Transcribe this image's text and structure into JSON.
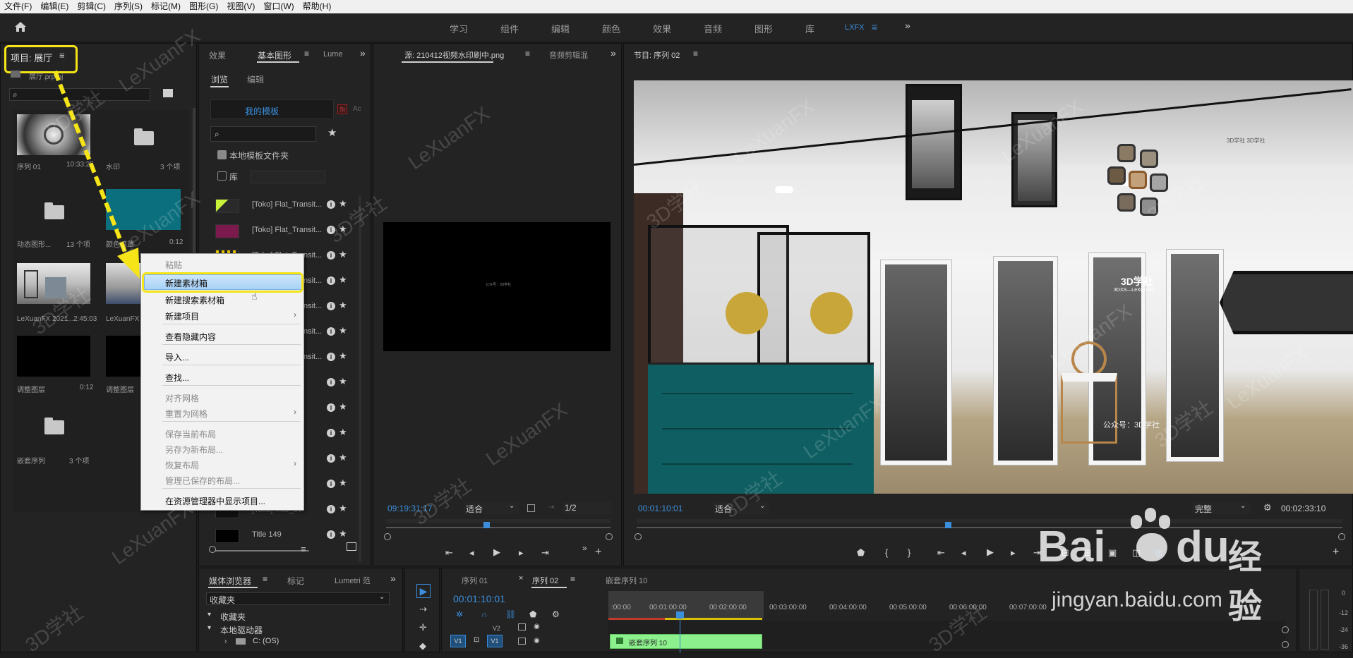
{
  "menu": [
    "文件(F)",
    "编辑(E)",
    "剪辑(C)",
    "序列(S)",
    "标记(M)",
    "图形(G)",
    "视图(V)",
    "窗口(W)",
    "帮助(H)"
  ],
  "workspaces": [
    "学习",
    "组件",
    "编辑",
    "颜色",
    "效果",
    "音频",
    "图形",
    "库",
    "LXFX"
  ],
  "project": {
    "title": "项目: 展厅",
    "path": "展厅.prproj",
    "items": [
      {
        "name": "序列 01",
        "meta": "10:33:25"
      },
      {
        "name": "水印",
        "meta": "3 个项"
      },
      {
        "name": "动态图形...",
        "meta": "13 个项"
      },
      {
        "name": "颜色遮罩",
        "meta": "0:12"
      },
      {
        "name": "LeXuanFX 2021...",
        "meta": "2:45:03"
      },
      {
        "name": "LeXuanFX 20...",
        "meta": ""
      },
      {
        "name": "调整图层",
        "meta": "0:12"
      },
      {
        "name": "调整图层",
        "meta": ""
      },
      {
        "name": "嵌套序列",
        "meta": "3 个项"
      }
    ]
  },
  "effects_panel": {
    "tabs": [
      "效果",
      "基本图形",
      "Lume"
    ],
    "subtabs": [
      "浏览",
      "编辑"
    ],
    "my_templates": "我的模板",
    "st_badge": "St",
    "ac_label": "Ac",
    "local_folder": "本地模板文件夹",
    "library": "库",
    "templates": [
      "[Toko] Flat_Transit...",
      "[Toko] Flat_Transit...",
      "[Toko] Flat_Transit...",
      "[Toko] Flat_Transit...",
      "[Toko] Flat_Transit...",
      "[Toko] Flat_Transit...",
      "[Toko] Flat_Transit...",
      "",
      "",
      "",
      "",
      "",
      "",
      "[Toko] Title_06",
      "Title 149"
    ]
  },
  "source_monitor": {
    "tab": "源: 210412视频水印刷中.png",
    "tab2": "音频剪辑混",
    "timecode": "09:19:31:17",
    "fit": "适合",
    "resolution": "1/2",
    "preview_caption": "公众号：3D学社"
  },
  "program_monitor": {
    "tab": "节目: 序列 02",
    "timecode": "00:01:10:01",
    "fit": "适合",
    "quality": "完整",
    "duration": "00:02:33:10",
    "overlay_logo": "3D学社",
    "overlay_sub": "3DXS—LeXuanFX",
    "overlay_caption": "公众号：3D学社",
    "overlay_top": "3D学社 3D学社"
  },
  "context_menu": [
    {
      "label": "粘贴",
      "disabled": true
    },
    {
      "label": "新建素材箱",
      "disabled": false,
      "highlight": true
    },
    {
      "label": "新建搜索素材箱",
      "disabled": false
    },
    {
      "label": "新建项目",
      "disabled": false,
      "submenu": true
    },
    {
      "label": "查看隐藏内容",
      "disabled": false
    },
    {
      "label": "导入...",
      "disabled": false
    },
    {
      "label": "查找...",
      "disabled": false
    },
    {
      "label": "对齐网格",
      "disabled": true
    },
    {
      "label": "重置为网格",
      "disabled": true,
      "submenu": true
    },
    {
      "label": "保存当前布局",
      "disabled": true
    },
    {
      "label": "另存为新布局...",
      "disabled": true
    },
    {
      "label": "恢复布局",
      "disabled": true,
      "submenu": true
    },
    {
      "label": "管理已保存的布局...",
      "disabled": true
    },
    {
      "label": "在资源管理器中显示项目...",
      "disabled": false
    }
  ],
  "media_browser": {
    "tabs": [
      "媒体浏览器",
      "标记",
      "Lumetri 范"
    ],
    "dropdown": "收藏夹",
    "tree": [
      "收藏夹",
      "本地驱动器",
      "C: (OS)"
    ]
  },
  "timeline": {
    "tabs": [
      "序列 01",
      "序列 02",
      "嵌套序列 10"
    ],
    "timecode": "00:01:10:01",
    "ruler": [
      ":00:00",
      "00:01:00:00",
      "00:02:00:00",
      "00:03:00:00",
      "00:04:00:00",
      "00:05:00:00",
      "00:06:00:00",
      "00:07:00:00"
    ],
    "tracks": [
      "V2",
      "V1"
    ],
    "clip": "嵌套序列 10",
    "source_patch": "V1"
  },
  "audio_meter": [
    "0",
    "-12",
    "-24",
    "-36"
  ],
  "watermarks": [
    "LeXuanFX",
    "3D学社"
  ],
  "baidu": {
    "brand": "Bai",
    "brand2": "du",
    "product": "经验",
    "url": "jingyan.baidu.com"
  },
  "colors": {
    "accent": "#3b8edb",
    "highlight": "#f5e417",
    "clip": "#8cf08c",
    "teal": "#0b6f7d"
  }
}
